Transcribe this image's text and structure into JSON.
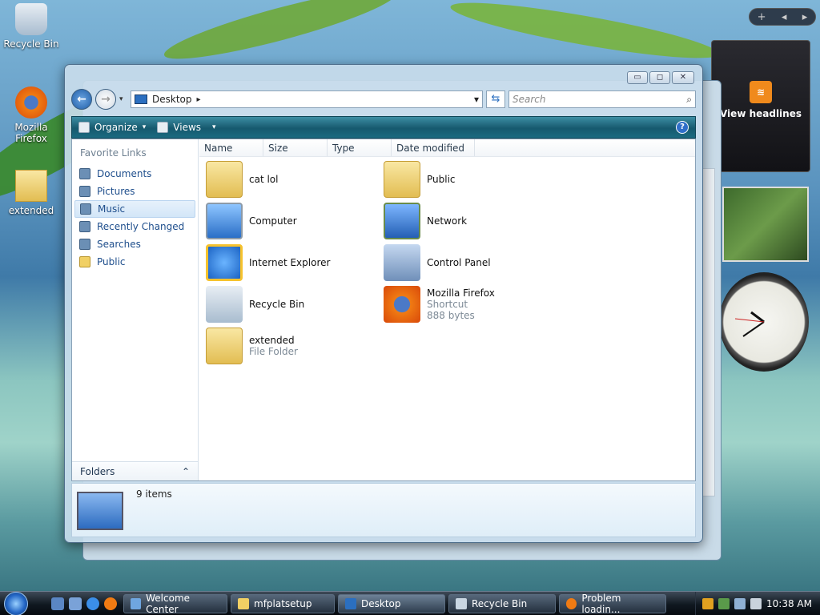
{
  "desktop": {
    "icons": [
      {
        "label": "Recycle Bin",
        "icon": "recycle-bin-icon"
      },
      {
        "label": "Mozilla\nFirefox",
        "icon": "firefox-icon"
      },
      {
        "label": "extended",
        "icon": "folder-icon"
      }
    ]
  },
  "gadgets": {
    "feeds_label": "View headlines",
    "bar_add": "+",
    "bar_prev": "◂",
    "bar_next": "▸"
  },
  "window": {
    "address": "Desktop",
    "address_sep": "▸",
    "search_placeholder": "Search",
    "toolbar": {
      "organize": "Organize",
      "views": "Views",
      "help": "?"
    },
    "caption": {
      "minimize": "▭",
      "maximize": "◻",
      "close": "✕"
    },
    "favorite_links_title": "Favorite Links",
    "favorite_links": [
      "Documents",
      "Pictures",
      "Music",
      "Recently Changed",
      "Searches",
      "Public"
    ],
    "folders_label": "Folders",
    "columns": [
      "Name",
      "Size",
      "Type",
      "Date modified"
    ],
    "items": [
      {
        "name": "cat lol",
        "sub1": "",
        "sub2": "",
        "icon": "archive-folder-icon"
      },
      {
        "name": "Public",
        "sub1": "",
        "sub2": "",
        "icon": "folder-icon"
      },
      {
        "name": "Computer",
        "sub1": "",
        "sub2": "",
        "icon": "computer-icon"
      },
      {
        "name": "Network",
        "sub1": "",
        "sub2": "",
        "icon": "network-icon"
      },
      {
        "name": "Internet Explorer",
        "sub1": "",
        "sub2": "",
        "icon": "internet-explorer-icon"
      },
      {
        "name": "Control Panel",
        "sub1": "",
        "sub2": "",
        "icon": "control-panel-icon"
      },
      {
        "name": "Recycle Bin",
        "sub1": "",
        "sub2": "",
        "icon": "recycle-bin-icon"
      },
      {
        "name": "Mozilla Firefox",
        "sub1": "Shortcut",
        "sub2": "888 bytes",
        "icon": "firefox-icon"
      },
      {
        "name": "extended",
        "sub1": "File Folder",
        "sub2": "",
        "icon": "folder-icon"
      }
    ],
    "status": "9 items"
  },
  "taskbar": {
    "buttons": [
      "Welcome Center",
      "mfplatsetup",
      "Desktop",
      "Recycle Bin",
      "Problem loadin..."
    ],
    "time": "10:38 AM"
  },
  "colors": {
    "accent": "#1b6a80",
    "link": "#1e4e8c"
  }
}
